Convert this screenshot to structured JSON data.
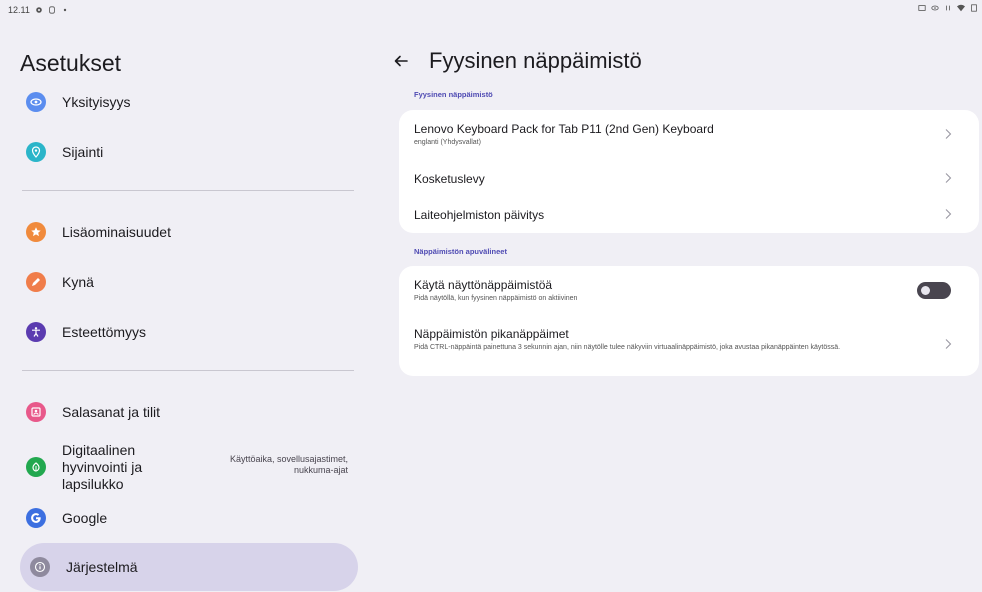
{
  "status_bar": {
    "time": "12.11"
  },
  "left_pane": {
    "title": "Asetukset",
    "items": [
      {
        "label": "Yksityisyys",
        "icon": "privacy-eye-icon",
        "color": "#5b8def"
      },
      {
        "label": "Sijainti",
        "icon": "location-pin-icon",
        "color": "#2bb5c9"
      },
      {
        "label": "Lisäominaisuudet",
        "icon": "star-icon",
        "color": "#f08a3c"
      },
      {
        "label": "Kynä",
        "icon": "pen-icon",
        "color": "#f07d4a"
      },
      {
        "label": "Esteettömyys",
        "icon": "accessibility-icon",
        "color": "#5b3bb0"
      },
      {
        "label": "Salasanat ja tilit",
        "icon": "account-box-icon",
        "color": "#e8588a"
      },
      {
        "label": "Digitaalinen hyvinvointi ja lapsilukko",
        "icon": "wellbeing-icon",
        "color": "#22a84f",
        "sub": "Käyttöaika, sovellusajastimet, nukkuma-ajat"
      },
      {
        "label": "Google",
        "icon": "google-icon",
        "color": "#3c6fe0"
      },
      {
        "label": "Järjestelmä",
        "icon": "info-icon",
        "color": "#8f8a9e",
        "selected": true
      }
    ]
  },
  "right_pane": {
    "title": "Fyysinen näppäimistö",
    "section1": {
      "label": "Fyysinen näppäimistö",
      "rows": [
        {
          "title": "Lenovo Keyboard Pack for Tab P11 (2nd Gen) Keyboard",
          "sub": "englanti (Yhdysvallat)"
        },
        {
          "title": "Kosketuslevy"
        },
        {
          "title": "Laiteohjelmiston päivitys"
        }
      ]
    },
    "section2": {
      "label": "Näppäimistön apuvälineet",
      "rows": [
        {
          "title": "Käytä näyttönäppäimistöä",
          "sub": "Pidä näytöllä, kun fyysinen näppäimistö on aktiivinen",
          "toggle": false
        },
        {
          "title": "Näppäimistön pikanäppäimet",
          "sub": "Pidä CTRL-näppäintä painettuna 3 sekunnin ajan, niin näytölle tulee näkyviin virtuaalinäppäimistö, joka avustaa pikanäppäinten käytössä."
        }
      ]
    }
  },
  "colors": {
    "accent": "#4f4bb3",
    "selected_bg": "#d7d3ea",
    "page_bg": "#f0eff5"
  }
}
